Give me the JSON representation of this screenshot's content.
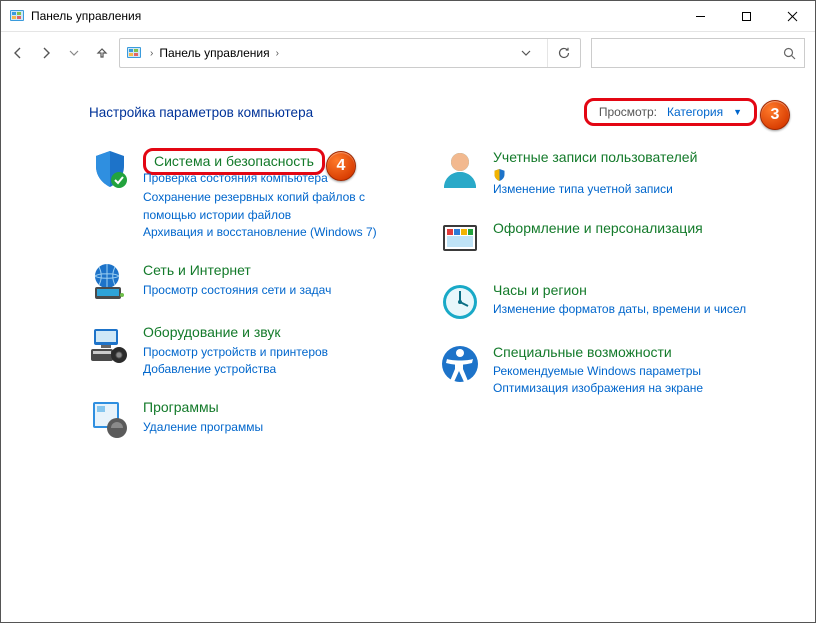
{
  "window": {
    "title": "Панель управления"
  },
  "breadcrumb": {
    "root": "Панель управления"
  },
  "content_header": "Настройка параметров компьютера",
  "view": {
    "label": "Просмотр:",
    "value": "Категория"
  },
  "badges": {
    "view": "3",
    "system": "4"
  },
  "left": [
    {
      "id": "system-security",
      "title": "Система и безопасность",
      "truncated": "Проверка состояния компьютера",
      "subs": [
        "Сохранение резервных копий файлов с помощью истории файлов",
        "Архивация и восстановление (Windows 7)"
      ]
    },
    {
      "id": "network",
      "title": "Сеть и Интернет",
      "subs": [
        "Просмотр состояния сети и задач"
      ]
    },
    {
      "id": "hardware",
      "title": "Оборудование и звук",
      "subs": [
        "Просмотр устройств и принтеров",
        "Добавление устройства"
      ]
    },
    {
      "id": "programs",
      "title": "Программы",
      "subs": [
        "Удаление программы"
      ]
    }
  ],
  "right": [
    {
      "id": "accounts",
      "title": "Учетные записи пользователей",
      "subs": [
        {
          "shield": true,
          "text": "Изменение типа учетной записи"
        }
      ]
    },
    {
      "id": "appearance",
      "title": "Оформление и персонализация",
      "subs": []
    },
    {
      "id": "clock",
      "title": "Часы и регион",
      "subs": [
        "Изменение форматов даты, времени и чисел"
      ]
    },
    {
      "id": "accessibility",
      "title": "Специальные возможности",
      "subs": [
        "Рекомендуемые Windows параметры",
        "Оптимизация изображения на экране"
      ]
    }
  ]
}
